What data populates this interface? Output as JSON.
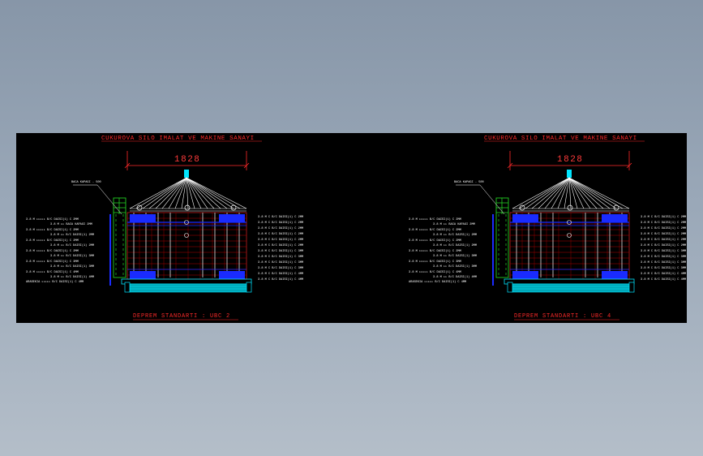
{
  "drawings": [
    {
      "company": "CUKUROVA SILO  IMALAT VE MAKINE SANAYI",
      "dimension": "1828",
      "standard": "DEPREM STANDARTI : UBC 2"
    },
    {
      "company": "CUKUROVA SILO  IMALAT VE MAKINE SANAYI",
      "dimension": "1828",
      "standard": "DEPREM STANDARTI : UBC 4"
    }
  ],
  "colors": {
    "background": "#000000",
    "red": "#ff2a2a",
    "blue": "#1a2bff",
    "cyan": "#00e5ff",
    "green": "#22cc22"
  }
}
